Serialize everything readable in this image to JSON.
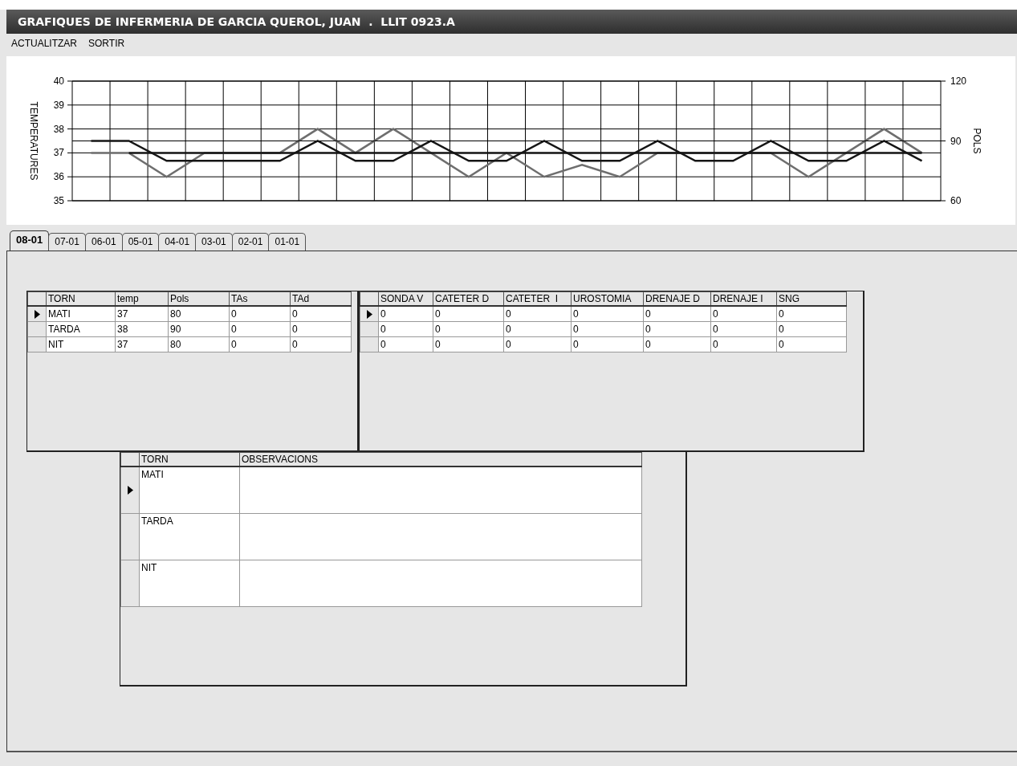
{
  "window": {
    "title": "GRAFIQUES DE INFERMERIA DE GARCIA QUEROL, JUAN  .  LLIT 0923.A"
  },
  "menu": [
    {
      "label": "ACTUALITZAR"
    },
    {
      "label": "SORTIR"
    }
  ],
  "chart": {
    "temperatures": {
      "chart_data": {
        "type": "line",
        "grid": true,
        "ylabel": "TEMPERATURES",
        "categories": [
          null,
          null,
          null,
          null,
          null,
          null,
          null,
          null,
          null,
          null,
          null,
          null,
          null,
          null,
          null,
          null,
          null,
          null,
          null,
          null,
          null,
          null,
          null
        ],
        "ylim": [
          35,
          40
        ],
        "yticks": [
          35,
          36,
          37,
          38,
          39,
          40
        ],
        "series": [
          {
            "color": "#6e6e6e",
            "values": [
              37,
              37,
              36,
              37,
              37,
              37,
              38,
              37,
              38,
              37,
              36,
              37,
              36,
              36.5,
              36,
              37,
              37,
              37,
              37,
              36,
              37,
              38,
              37
            ]
          },
          {
            "color": "#151515",
            "values": [
              null,
              37,
              37,
              37,
              37,
              37,
              37,
              37,
              37,
              37,
              37,
              37,
              37,
              37,
              37,
              37,
              37,
              37,
              37,
              37,
              37,
              37,
              37
            ]
          }
        ]
      }
    },
    "pulse": {
      "chart_data": {
        "type": "line",
        "ylabel": "POLS",
        "categories": [
          null,
          null,
          null,
          null,
          null,
          null,
          null,
          null,
          null,
          null,
          null,
          null,
          null,
          null,
          null,
          null,
          null,
          null,
          null,
          null,
          null,
          null,
          null
        ],
        "ylim": [
          60,
          120
        ],
        "yticks": [
          60,
          90,
          120
        ],
        "series": [
          {
            "color": "#151515",
            "values": [
              90,
              90,
              80,
              80,
              80,
              80,
              90,
              80,
              80,
              90,
              80,
              80,
              90,
              80,
              80,
              90,
              80,
              80,
              90,
              80,
              80,
              90,
              80
            ]
          }
        ]
      }
    }
  },
  "tabs": [
    {
      "label": "08-01",
      "selected": true
    },
    {
      "label": "07-01",
      "selected": false
    },
    {
      "label": "06-01",
      "selected": false
    },
    {
      "label": "05-01",
      "selected": false
    },
    {
      "label": "04-01",
      "selected": false
    },
    {
      "label": "03-01",
      "selected": false
    },
    {
      "label": "02-01",
      "selected": false
    },
    {
      "label": "01-01",
      "selected": false
    }
  ],
  "vitals_table": {
    "columns": [
      "TORN",
      "temp",
      "Pols",
      "TAs",
      "TAd"
    ],
    "rows": [
      {
        "selected": true,
        "cells": [
          "MATI",
          "37",
          "80",
          "0",
          "0"
        ]
      },
      {
        "selected": false,
        "cells": [
          "TARDA",
          "38",
          "90",
          "0",
          "0"
        ]
      },
      {
        "selected": false,
        "cells": [
          "NIT",
          "37",
          "80",
          "0",
          "0"
        ]
      }
    ]
  },
  "drainage_table": {
    "columns": [
      "SONDA V",
      "CATETER D",
      "CATETER  I",
      "UROSTOMIA",
      "DRENAJE D",
      "DRENAJE I",
      "SNG"
    ],
    "rows": [
      {
        "selected": true,
        "cells": [
          "0",
          "0",
          "0",
          "0",
          "0",
          "0",
          "0"
        ]
      },
      {
        "selected": false,
        "cells": [
          "0",
          "0",
          "0",
          "0",
          "0",
          "0",
          "0"
        ]
      },
      {
        "selected": false,
        "cells": [
          "0",
          "0",
          "0",
          "0",
          "0",
          "0",
          "0"
        ]
      }
    ]
  },
  "observations_table": {
    "columns": [
      "TORN",
      "OBSERVACIONS"
    ],
    "rows": [
      {
        "selected": true,
        "cells": [
          "MATI"
        ]
      },
      {
        "selected": false,
        "cells": [
          "TARDA"
        ]
      },
      {
        "selected": false,
        "cells": [
          "NIT"
        ]
      }
    ]
  }
}
